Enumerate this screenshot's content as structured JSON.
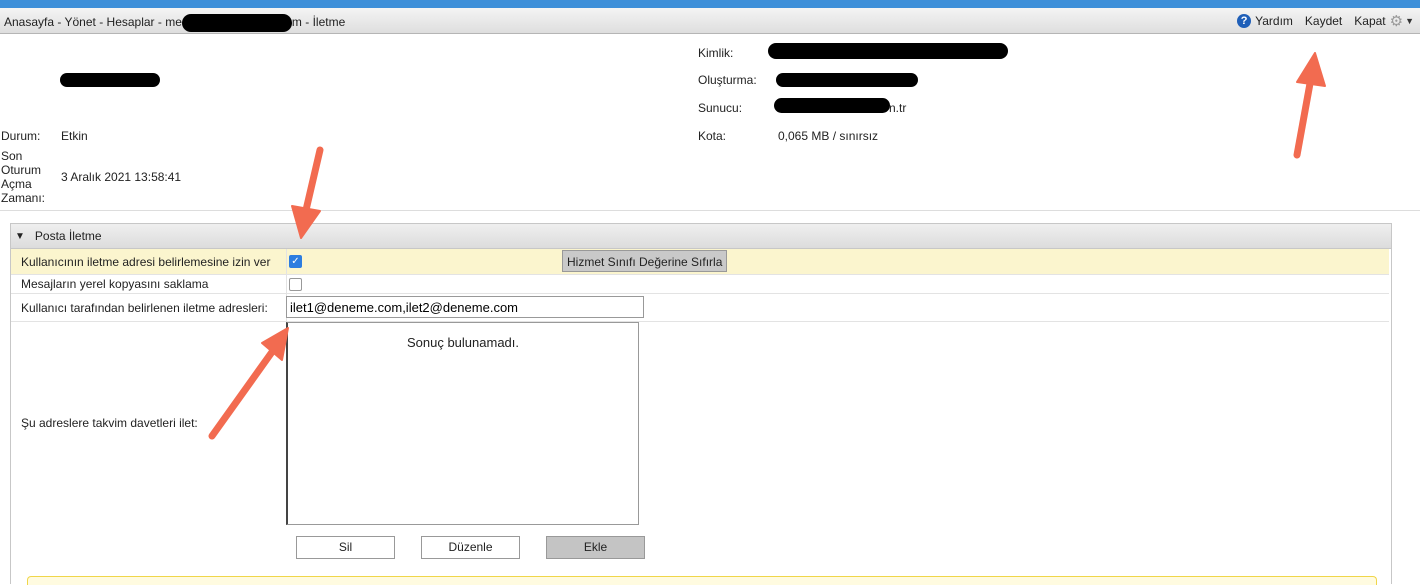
{
  "breadcrumb": {
    "home": "Anasayfa",
    "sep1": " - ",
    "manage": "Yönet",
    "sep2": " - ",
    "accounts": "Hesaplar",
    "sep3": " - ",
    "account_prefix": "me",
    "account_suffix": "m",
    "sep4": " - ",
    "page": "İletme"
  },
  "toolbar": {
    "help": "Yardım",
    "save": "Kaydet",
    "close": "Kapat"
  },
  "account": {
    "status_label": "Durum:",
    "status_value": "Etkin",
    "last_login_label_1": "Son",
    "last_login_label_2": "Oturum",
    "last_login_label_3": "Açma",
    "last_login_label_4": "Zamanı:",
    "last_login_value": "3 Aralık 2021 13:58:41",
    "id_label": "Kimlik:",
    "created_label": "Oluşturma:",
    "server_label": "Sunucu:",
    "server_suffix": "n.tr",
    "quota_label": "Kota:",
    "quota_value": "0,065 MB / sınırsız"
  },
  "forwarding": {
    "section_title": "Posta İletme",
    "allow_user_label": "Kullanıcının iletme adresi belirlemesine izin ver",
    "allow_user_checked": true,
    "reset_button": "Hizmet Sınıfı Değerine Sıfırla",
    "no_local_copy_label": "Mesajların yerel kopyasını saklama",
    "no_local_copy_checked": false,
    "user_addresses_label": "Kullanıcı tarafından belirlenen iletme adresleri:",
    "user_addresses_value": "ilet1@deneme.com,ilet2@deneme.com",
    "calendar_label": "Şu adreslere takvim davetleri ilet:",
    "calendar_empty": "Sonuç bulunamadı.",
    "delete_button": "Sil",
    "edit_button": "Düzenle",
    "add_button": "Ekle"
  },
  "colors": {
    "highlight_row": "#fbf5ce",
    "annotation_arrow": "#f26b50",
    "accent": "#2d7de0"
  }
}
